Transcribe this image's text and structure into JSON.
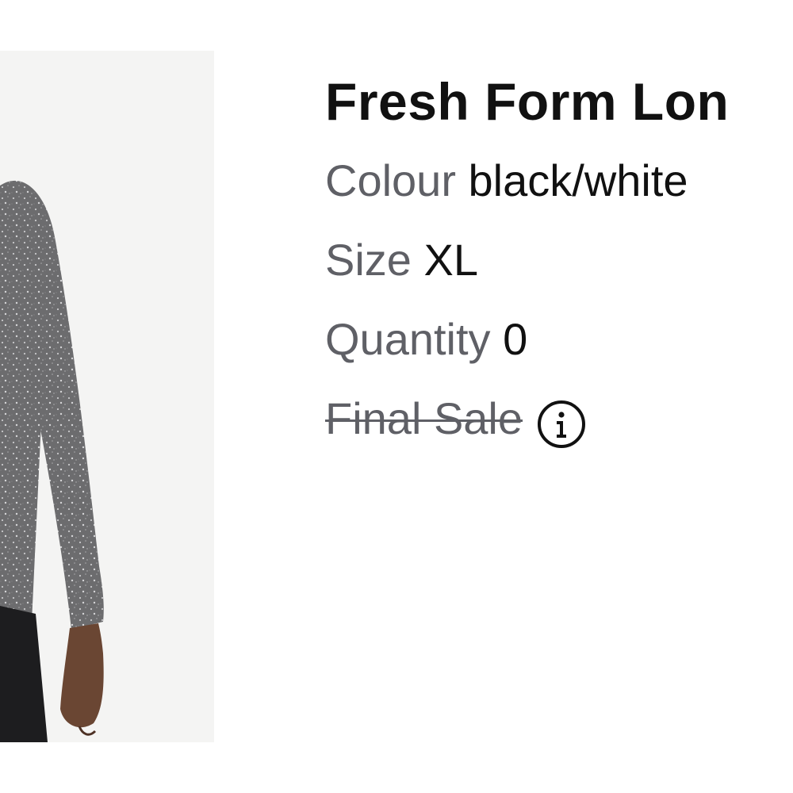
{
  "product": {
    "title": "Fresh Form Lon",
    "colour_label": "Colour",
    "colour_value": "black/white",
    "size_label": "Size",
    "size_value": "XL",
    "quantity_label": "Quantity",
    "quantity_value": "0",
    "final_sale_label": "Final Sale"
  },
  "icons": {
    "info": "info-circle-icon"
  },
  "colors": {
    "text_primary": "#111111",
    "text_secondary": "#5f6066",
    "image_background": "#f4f4f3"
  }
}
